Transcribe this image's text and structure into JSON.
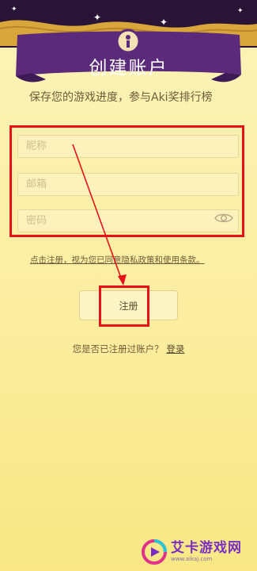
{
  "header": {
    "title": "创建账户"
  },
  "subtitle": "保存您的游戏进度，参与Aki奖排行榜",
  "form": {
    "nickname_placeholder": "昵称",
    "email_placeholder": "邮箱",
    "password_placeholder": "密码"
  },
  "policy_text": "点击注册，视为您已同意隐私政策和使用条款。",
  "register_label": "注册",
  "login": {
    "prompt": "您是否已注册过账户？",
    "link": "登录"
  },
  "watermark": {
    "name": "艾卡游戏网",
    "url": "www.aikaj.com"
  },
  "colors": {
    "highlight": "#e8111a",
    "banner": "#5b2a7a",
    "background": "#fbeea0"
  }
}
